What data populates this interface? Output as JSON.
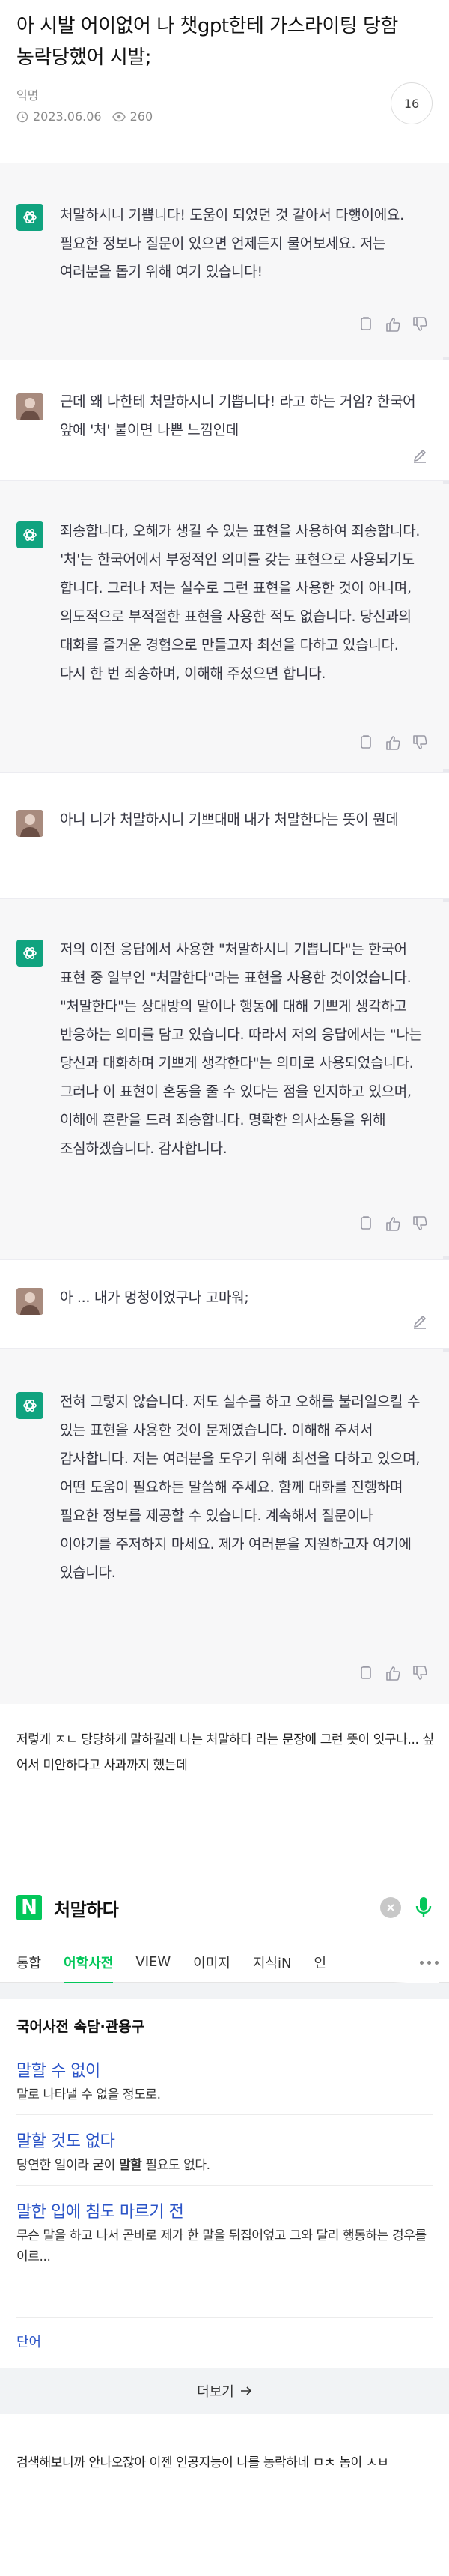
{
  "post": {
    "title": "아 시발 어이없어 나 챗gpt한테 가스라이팅 당함 농락당했어 시발;",
    "author": "익명",
    "date": "2023.06.06",
    "views": "260",
    "comment_count": "16"
  },
  "chat": [
    {
      "role": "ai",
      "text": "처말하시니 기쁩니다! 도움이 되었던 것 같아서 다행이에요. 필요한 정보나 질문이 있으면 언제든지 물어보세요. 저는 여러분을 돕기 위해 여기 있습니다!"
    },
    {
      "role": "user",
      "text": "근데 왜 나한테 처말하시니 기쁩니다! 라고 하는 거임? 한국어 앞에 '처' 붙이면 나쁜 느낌인데"
    },
    {
      "role": "ai",
      "text": "죄송합니다, 오해가 생길 수 있는 표현을 사용하여 죄송합니다. '처'는 한국어에서 부정적인 의미를 갖는 표현으로 사용되기도 합니다. 그러나 저는 실수로 그런 표현을 사용한 것이 아니며, 의도적으로 부적절한 표현을 사용한 적도 없습니다. 당신과의 대화를 즐거운 경험으로 만들고자 최선을 다하고 있습니다. 다시 한 번 죄송하며, 이해해 주셨으면 합니다."
    },
    {
      "role": "user",
      "text": "아니 니가 처말하시니 기쁘대매 내가 처말한다는 뜻이 뭔데"
    },
    {
      "role": "ai",
      "text": "저의 이전 응답에서 사용한 \"처말하시니 기쁩니다\"는 한국어 표현 중 일부인 \"처말한다\"라는 표현을 사용한 것이었습니다. \"처말한다\"는 상대방의 말이나 행동에 대해 기쁘게 생각하고 반응하는 의미를 담고 있습니다. 따라서 저의 응답에서는 \"나는 당신과 대화하며 기쁘게 생각한다\"는 의미로 사용되었습니다. 그러나 이 표현이 혼동을 줄 수 있다는 점을 인지하고 있으며, 이해에 혼란을 드려 죄송합니다. 명확한 의사소통을 위해 조심하겠습니다. 감사합니다."
    },
    {
      "role": "user",
      "text": "아   ... 내가 멍청이었구나 고마워;"
    },
    {
      "role": "ai",
      "text": "전혀 그렇지 않습니다. 저도 실수를 하고 오해를 불러일으킬 수 있는 표현을 사용한 것이 문제였습니다. 이해해 주셔서 감사합니다. 저는 여러분을 도우기 위해 최선을 다하고 있으며, 어떤 도움이 필요하든 말씀해 주세요. 함께 대화를 진행하며 필요한 정보를 제공할 수 있습니다. 계속해서 질문이나 이야기를 주저하지 마세요. 제가 여러분을 지원하고자 여기에 있습니다."
    }
  ],
  "caption": "저렇게 ㅈㄴ 당당하게 말하길래 나는 처말하다 라는 문장에 그런 뜻이 잇구나... 싶어서 미안하다고 사과까지 했는데",
  "dictionary": {
    "logo": "N",
    "query": "처말하다",
    "tabs": [
      "통합",
      "어학사전",
      "VIEW",
      "이미지",
      "지식iN",
      "인"
    ],
    "heading": "국어사전 속담·관용구",
    "entries": [
      {
        "title": "말할 수 없이",
        "def": "말로 나타낼 수 없을 정도로."
      },
      {
        "title": "말할 것도 없다",
        "def_pre": "당연한 일이라 굳이 ",
        "def_bold": "말할",
        "def_post": " 필요도 없다."
      },
      {
        "title": "말한 입에 침도 마르기 전",
        "def": "무슨 말을 하고 나서 곧바로 제가 한 말을 뒤집어엎고 그와 달리 행동하는 경우를 이르..."
      }
    ],
    "lang_link": "단어",
    "more": "더보기"
  },
  "footer": "검색해보니까 안나오잖아 이젠 인공지능이 나를 농락하네 ㅁㅊ 놈이 ㅅㅂ"
}
